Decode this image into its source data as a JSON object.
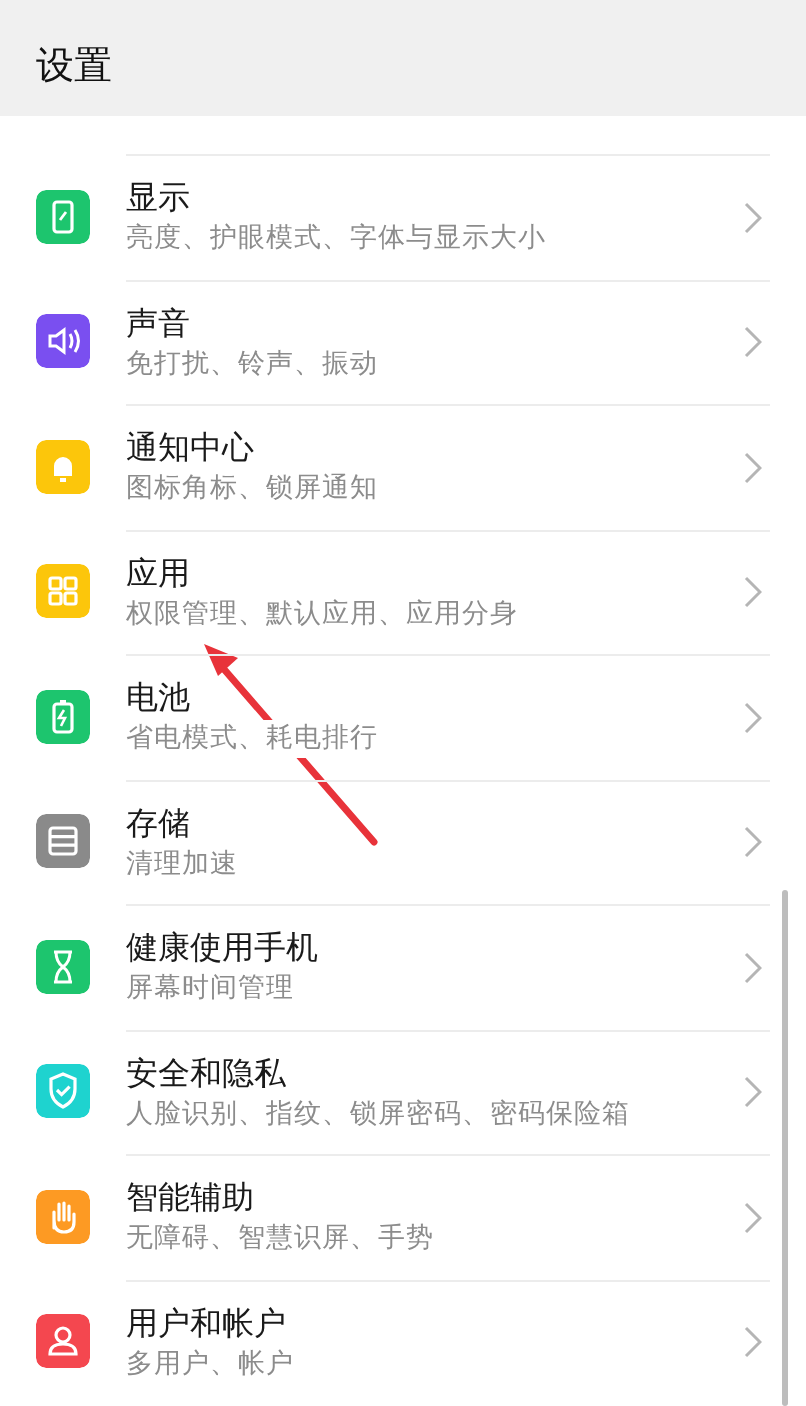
{
  "header": {
    "title": "设置"
  },
  "items": [
    {
      "title": "显示",
      "subtitle": "亮度、护眼模式、字体与显示大小",
      "color": "#1dc56e"
    },
    {
      "title": "声音",
      "subtitle": "免打扰、铃声、振动",
      "color": "#7a4ff0"
    },
    {
      "title": "通知中心",
      "subtitle": "图标角标、锁屏通知",
      "color": "#fcc60b"
    },
    {
      "title": "应用",
      "subtitle": "权限管理、默认应用、应用分身",
      "color": "#fcc60b"
    },
    {
      "title": "电池",
      "subtitle": "省电模式、耗电排行",
      "color": "#1dc56e"
    },
    {
      "title": "存储",
      "subtitle": "清理加速",
      "color": "#8a8a8a"
    },
    {
      "title": "健康使用手机",
      "subtitle": "屏幕时间管理",
      "color": "#1dc56e"
    },
    {
      "title": "安全和隐私",
      "subtitle": "人脸识别、指纹、锁屏密码、密码保险箱",
      "color": "#1ed3cf"
    },
    {
      "title": "智能辅助",
      "subtitle": "无障碍、智慧识屏、手势",
      "color": "#fd9a23"
    },
    {
      "title": "用户和帐户",
      "subtitle": "多用户、帐户",
      "color": "#f4474f"
    }
  ],
  "annotation": {
    "kind": "arrow",
    "color": "#e8333a"
  }
}
